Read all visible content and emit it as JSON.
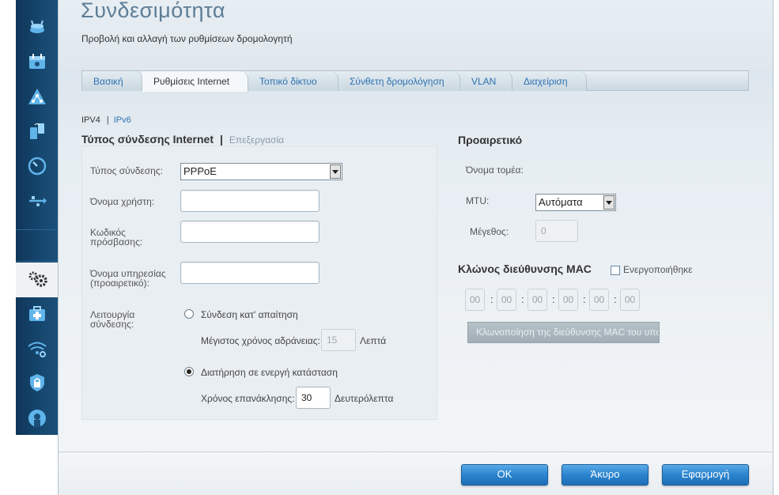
{
  "header": {
    "title": "Συνδεσιμότητα",
    "subtitle": "Προβολή και αλλαγή των ρυθμίσεων δρομολογητή"
  },
  "sidebar": {
    "items": [
      {
        "icon": "router-icon"
      },
      {
        "icon": "calendar-icon"
      },
      {
        "icon": "network-map-icon"
      },
      {
        "icon": "devices-icon"
      },
      {
        "icon": "speedometer-icon"
      },
      {
        "icon": "usb-icon"
      },
      {
        "icon": "gear-icon",
        "active": true
      },
      {
        "icon": "first-aid-icon"
      },
      {
        "icon": "wifi-gear-icon"
      },
      {
        "icon": "security-shield-icon"
      },
      {
        "icon": "parental-controls-icon"
      }
    ]
  },
  "tabs": [
    {
      "label": "Βασική"
    },
    {
      "label": "Ρυθμίσεις Internet",
      "active": true
    },
    {
      "label": "Τοπικό δίκτυο"
    },
    {
      "label": "Σύνθετη δρομολόγηση"
    },
    {
      "label": "VLAN"
    },
    {
      "label": "Διαχείριση"
    }
  ],
  "ipv": {
    "v4": "IPV4",
    "separator": "|",
    "v6": "IPv6"
  },
  "connection": {
    "title": "Τύπος σύνδεσης Internet",
    "separator": "|",
    "edit": "Επεξεργασία",
    "type_label": "Τύπος σύνδεσης:",
    "type_value": "PPPoE",
    "username_label": "Όνομα χρήστη:",
    "username_value": "",
    "password_label": "Κωδικός πρόσβασης:",
    "password_value": "",
    "service_label": "Όνομα υπηρεσίας (προαιρετικό):",
    "service_value": "",
    "mode_label": "Λειτουργία σύνδεσης:",
    "on_demand_label": "Σύνδεση κατ' απαίτηση",
    "max_idle_label": "Μέγιστος χρόνος αδράνειας:",
    "max_idle_value": "15",
    "max_idle_unit": "Λεπτά",
    "keep_alive_label": "Διατήρηση σε ενεργή κατάσταση",
    "keep_alive_selected": true,
    "redial_label": "Χρόνος επανάκλησης:",
    "redial_value": "30",
    "redial_unit": "Δευτερόλεπτα"
  },
  "optional": {
    "title": "Προαιρετικό",
    "domain_label": "Όνομα τομέα:",
    "mtu_label": "MTU:",
    "mtu_value": "Αυτόματα",
    "size_label": "Μέγεθος:",
    "size_value": "0"
  },
  "mac_clone": {
    "title": "Κλώνος διεύθυνσης MAC",
    "enabled_label": "Ενεργοποιήθηκε",
    "enabled": false,
    "octets": [
      "00",
      "00",
      "00",
      "00",
      "00",
      "00"
    ],
    "separator": ":",
    "clone_button": "Κλωνοποίηση της διεύθυνσης MAC του υπολογιστή μου"
  },
  "footer": {
    "ok": "OK",
    "cancel": "Άκυρο",
    "apply": "Εφαρμογή"
  },
  "colors": {
    "accent": "#2e72b2",
    "sidebar": "#16476f",
    "button": "#2a84cf"
  }
}
